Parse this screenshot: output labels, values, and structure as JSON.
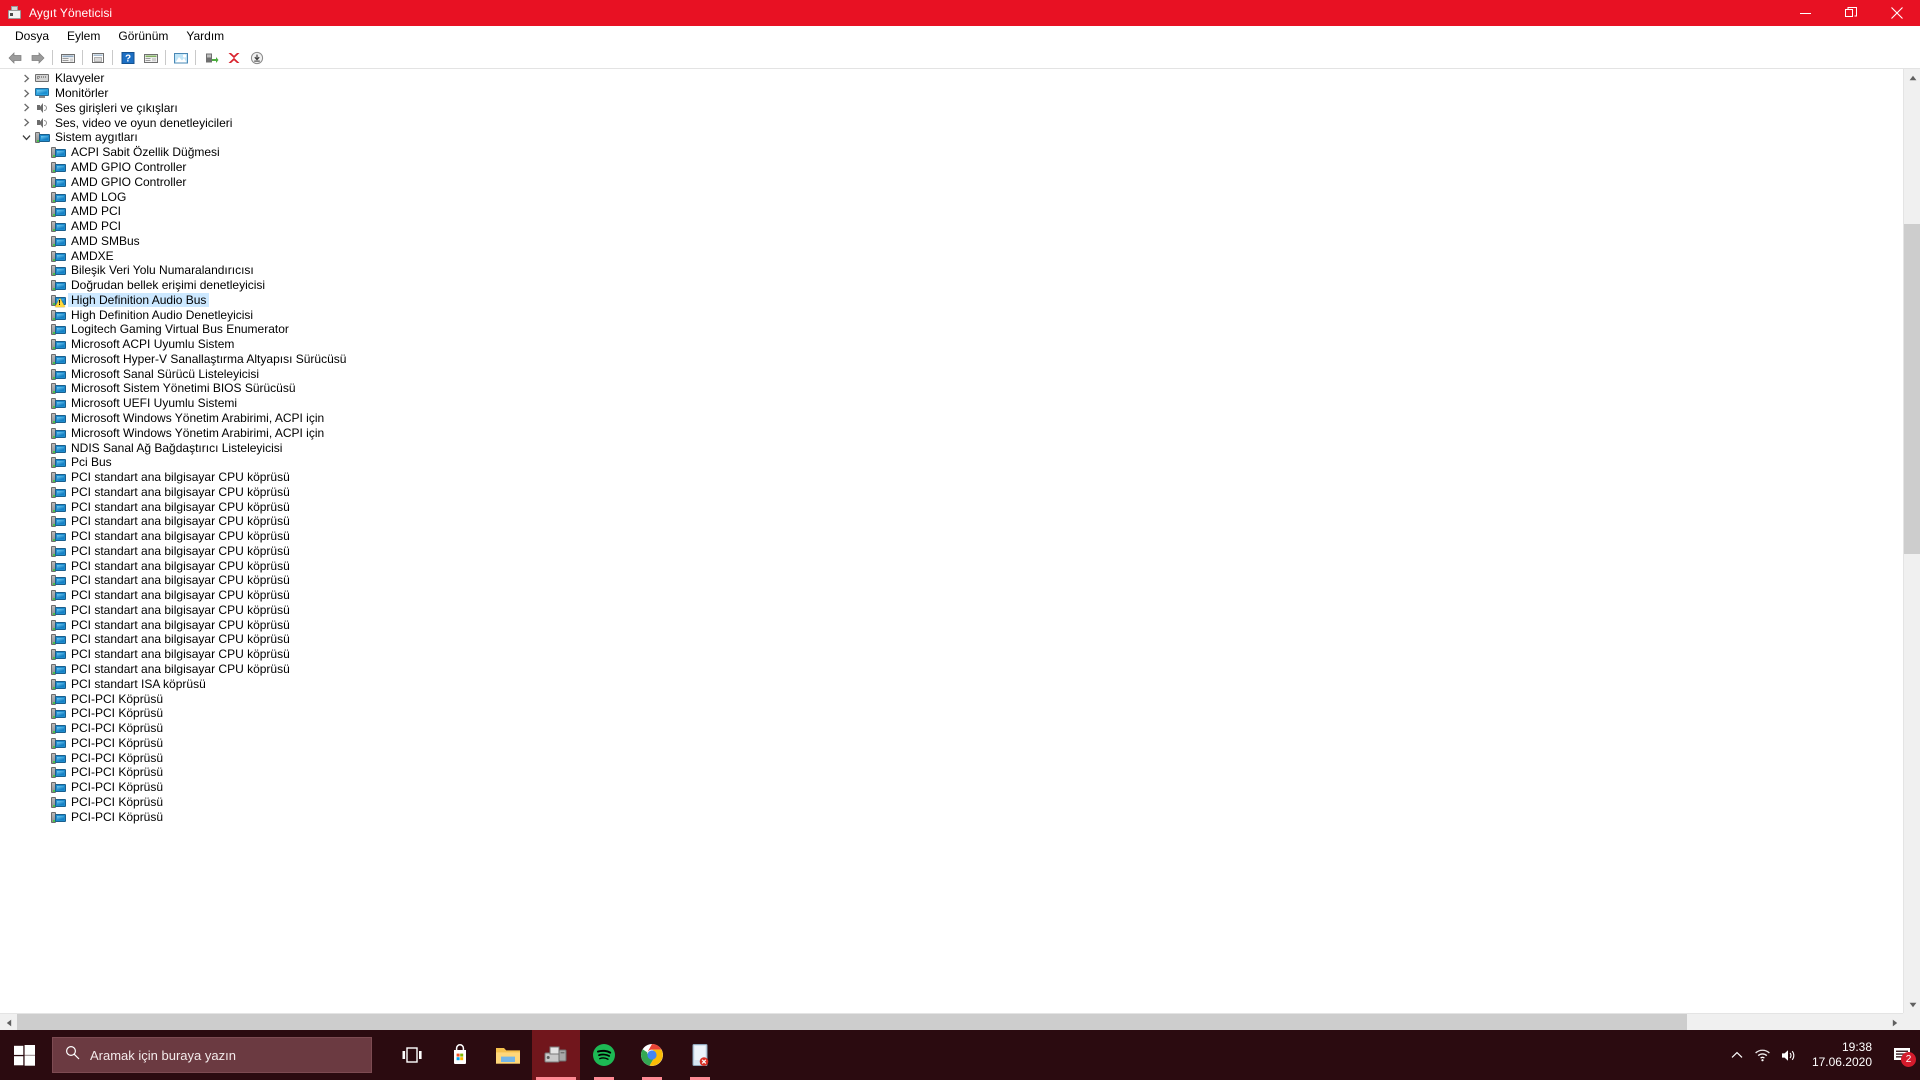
{
  "window": {
    "title": "Aygıt Yöneticisi",
    "icon": "device-manager-icon",
    "controls": {
      "minimize": "minimize-button",
      "maximize": "restore-button",
      "close": "close-button"
    }
  },
  "menu": [
    {
      "label": "Dosya"
    },
    {
      "label": "Eylem"
    },
    {
      "label": "Görünüm"
    },
    {
      "label": "Yardım"
    }
  ],
  "toolbar": [
    {
      "name": "back-icon"
    },
    {
      "name": "forward-icon"
    },
    {
      "sep": true
    },
    {
      "name": "show-hide-console-tree-icon"
    },
    {
      "sep": true
    },
    {
      "name": "properties-icon"
    },
    {
      "sep": true
    },
    {
      "name": "help-icon"
    },
    {
      "name": "scan-hardware-changes-icon"
    },
    {
      "sep": true
    },
    {
      "name": "update-driver-icon"
    },
    {
      "sep": true
    },
    {
      "name": "enable-device-icon"
    },
    {
      "name": "uninstall-device-icon"
    },
    {
      "name": "scan-for-changes-icon"
    }
  ],
  "tree": [
    {
      "label": "Klavyeler",
      "level": 0,
      "icon": "keyboard-icon",
      "expanded": false,
      "selected": false
    },
    {
      "label": "Monitörler",
      "level": 0,
      "icon": "monitor-icon",
      "expanded": false,
      "selected": false
    },
    {
      "label": "Ses girişleri ve çıkışları",
      "level": 0,
      "icon": "speaker-icon",
      "expanded": false,
      "selected": false
    },
    {
      "label": "Ses, video ve oyun denetleyicileri",
      "level": 0,
      "icon": "speaker-icon",
      "expanded": false,
      "selected": false
    },
    {
      "label": "Sistem aygıtları",
      "level": 0,
      "icon": "device-icon",
      "expanded": true,
      "selected": false
    },
    {
      "label": "ACPI Sabit Özellik Düğmesi",
      "level": 1,
      "icon": "device-icon",
      "selected": false
    },
    {
      "label": "AMD GPIO Controller",
      "level": 1,
      "icon": "device-icon",
      "selected": false
    },
    {
      "label": "AMD GPIO Controller",
      "level": 1,
      "icon": "device-icon",
      "selected": false
    },
    {
      "label": "AMD LOG",
      "level": 1,
      "icon": "device-icon",
      "selected": false
    },
    {
      "label": "AMD PCI",
      "level": 1,
      "icon": "device-icon",
      "selected": false
    },
    {
      "label": "AMD PCI",
      "level": 1,
      "icon": "device-icon",
      "selected": false
    },
    {
      "label": "AMD SMBus",
      "level": 1,
      "icon": "device-icon",
      "selected": false
    },
    {
      "label": "AMDXE",
      "level": 1,
      "icon": "device-icon",
      "selected": false
    },
    {
      "label": "Bileşik Veri Yolu Numaralandırıcısı",
      "level": 1,
      "icon": "device-icon",
      "selected": false
    },
    {
      "label": "Doğrudan bellek erişimi denetleyicisi",
      "level": 1,
      "icon": "device-icon",
      "selected": false
    },
    {
      "label": "High Definition Audio Bus",
      "level": 1,
      "icon": "device-warning-icon",
      "selected": true
    },
    {
      "label": "High Definition Audio Denetleyicisi",
      "level": 1,
      "icon": "device-icon",
      "selected": false
    },
    {
      "label": "Logitech Gaming Virtual Bus Enumerator",
      "level": 1,
      "icon": "device-icon",
      "selected": false
    },
    {
      "label": "Microsoft ACPI Uyumlu Sistem",
      "level": 1,
      "icon": "device-icon",
      "selected": false
    },
    {
      "label": "Microsoft Hyper-V Sanallaştırma Altyapısı Sürücüsü",
      "level": 1,
      "icon": "device-icon",
      "selected": false
    },
    {
      "label": "Microsoft Sanal Sürücü Listeleyicisi",
      "level": 1,
      "icon": "device-icon",
      "selected": false
    },
    {
      "label": "Microsoft Sistem Yönetimi BIOS Sürücüsü",
      "level": 1,
      "icon": "device-icon",
      "selected": false
    },
    {
      "label": "Microsoft UEFI Uyumlu Sistemi",
      "level": 1,
      "icon": "device-icon",
      "selected": false
    },
    {
      "label": "Microsoft Windows Yönetim Arabirimi, ACPI için",
      "level": 1,
      "icon": "device-icon",
      "selected": false
    },
    {
      "label": "Microsoft Windows Yönetim Arabirimi, ACPI için",
      "level": 1,
      "icon": "device-icon",
      "selected": false
    },
    {
      "label": "NDIS Sanal Ağ Bağdaştırıcı Listeleyicisi",
      "level": 1,
      "icon": "device-icon",
      "selected": false
    },
    {
      "label": "Pci Bus",
      "level": 1,
      "icon": "device-icon",
      "selected": false
    },
    {
      "label": "PCI standart ana bilgisayar CPU köprüsü",
      "level": 1,
      "icon": "device-icon",
      "selected": false
    },
    {
      "label": "PCI standart ana bilgisayar CPU köprüsü",
      "level": 1,
      "icon": "device-icon",
      "selected": false
    },
    {
      "label": "PCI standart ana bilgisayar CPU köprüsü",
      "level": 1,
      "icon": "device-icon",
      "selected": false
    },
    {
      "label": "PCI standart ana bilgisayar CPU köprüsü",
      "level": 1,
      "icon": "device-icon",
      "selected": false
    },
    {
      "label": "PCI standart ana bilgisayar CPU köprüsü",
      "level": 1,
      "icon": "device-icon",
      "selected": false
    },
    {
      "label": "PCI standart ana bilgisayar CPU köprüsü",
      "level": 1,
      "icon": "device-icon",
      "selected": false
    },
    {
      "label": "PCI standart ana bilgisayar CPU köprüsü",
      "level": 1,
      "icon": "device-icon",
      "selected": false
    },
    {
      "label": "PCI standart ana bilgisayar CPU köprüsü",
      "level": 1,
      "icon": "device-icon",
      "selected": false
    },
    {
      "label": "PCI standart ana bilgisayar CPU köprüsü",
      "level": 1,
      "icon": "device-icon",
      "selected": false
    },
    {
      "label": "PCI standart ana bilgisayar CPU köprüsü",
      "level": 1,
      "icon": "device-icon",
      "selected": false
    },
    {
      "label": "PCI standart ana bilgisayar CPU köprüsü",
      "level": 1,
      "icon": "device-icon",
      "selected": false
    },
    {
      "label": "PCI standart ana bilgisayar CPU köprüsü",
      "level": 1,
      "icon": "device-icon",
      "selected": false
    },
    {
      "label": "PCI standart ana bilgisayar CPU köprüsü",
      "level": 1,
      "icon": "device-icon",
      "selected": false
    },
    {
      "label": "PCI standart ana bilgisayar CPU köprüsü",
      "level": 1,
      "icon": "device-icon",
      "selected": false
    },
    {
      "label": "PCI standart ISA köprüsü",
      "level": 1,
      "icon": "device-icon",
      "selected": false
    },
    {
      "label": "PCI-PCI Köprüsü",
      "level": 1,
      "icon": "device-icon",
      "selected": false
    },
    {
      "label": "PCI-PCI Köprüsü",
      "level": 1,
      "icon": "device-icon",
      "selected": false
    },
    {
      "label": "PCI-PCI Köprüsü",
      "level": 1,
      "icon": "device-icon",
      "selected": false
    },
    {
      "label": "PCI-PCI Köprüsü",
      "level": 1,
      "icon": "device-icon",
      "selected": false
    },
    {
      "label": "PCI-PCI Köprüsü",
      "level": 1,
      "icon": "device-icon",
      "selected": false
    },
    {
      "label": "PCI-PCI Köprüsü",
      "level": 1,
      "icon": "device-icon",
      "selected": false
    },
    {
      "label": "PCI-PCI Köprüsü",
      "level": 1,
      "icon": "device-icon",
      "selected": false
    },
    {
      "label": "PCI-PCI Köprüsü",
      "level": 1,
      "icon": "device-icon",
      "selected": false
    },
    {
      "label": "PCI-PCI Köprüsü",
      "level": 1,
      "icon": "device-icon",
      "selected": false
    }
  ],
  "taskbar": {
    "start": "windows-start-icon",
    "search": {
      "placeholder": "Aramak için buraya yazın",
      "icon": "search-icon"
    },
    "apps": [
      {
        "name": "task-view-icon",
        "state": "idle"
      },
      {
        "name": "microsoft-store-icon",
        "state": "idle"
      },
      {
        "name": "file-explorer-icon",
        "state": "idle"
      },
      {
        "name": "device-manager-icon",
        "state": "active"
      },
      {
        "name": "spotify-icon",
        "state": "running"
      },
      {
        "name": "google-chrome-icon",
        "state": "running"
      },
      {
        "name": "error-app-icon",
        "state": "running"
      }
    ],
    "tray": {
      "overflow": "show-hidden-icons-chevron",
      "network": "wifi-icon",
      "volume": "volume-icon",
      "time": "19:38",
      "date": "17.06.2020",
      "notifications": {
        "icon": "action-center-icon",
        "count": "2"
      }
    }
  },
  "colors": {
    "titlebar": "#e81123",
    "taskbar": "#2b0b10",
    "selection": "#cce8ff",
    "accent_badge": "#d41b2c"
  }
}
